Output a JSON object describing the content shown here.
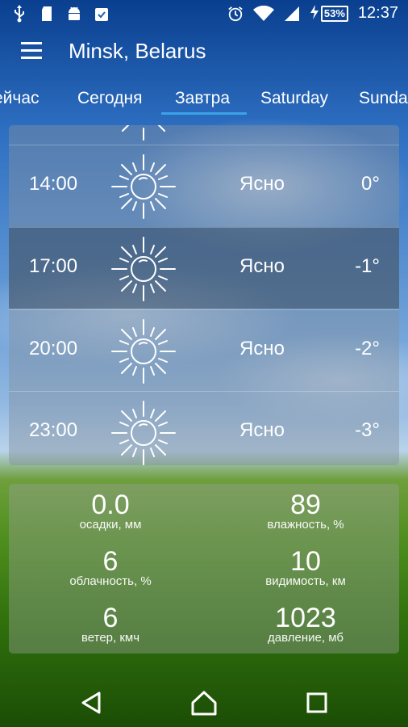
{
  "status_bar": {
    "left_icons": [
      "usb-icon",
      "sd-card-icon",
      "android-icon",
      "clipboard-check-icon"
    ],
    "right_icons": [
      "alarm-icon",
      "wifi-icon",
      "signal-icon",
      "charging-icon"
    ],
    "battery": "53%",
    "time": "12:37"
  },
  "app_bar": {
    "menu_icon": "hamburger-menu-icon",
    "city": "Minsk, Belarus"
  },
  "tabs": [
    {
      "label": "ейчас"
    },
    {
      "label": "Сегодня"
    },
    {
      "label": "Завтра",
      "selected": true
    },
    {
      "label": "Saturday"
    },
    {
      "label": "Sunda"
    }
  ],
  "accent_color": "#3aa3e8",
  "hourly": [
    {
      "time": "14:00",
      "condition": "Ясно",
      "temp": "0°",
      "icon": "sun-icon"
    },
    {
      "time": "17:00",
      "condition": "Ясно",
      "temp": "-1°",
      "icon": "sun-icon"
    },
    {
      "time": "20:00",
      "condition": "Ясно",
      "temp": "-2°",
      "icon": "sun-icon"
    },
    {
      "time": "23:00",
      "condition": "Ясно",
      "temp": "-3°",
      "icon": "sun-icon"
    }
  ],
  "stats": [
    {
      "value": "0.0",
      "label": "осадки, мм"
    },
    {
      "value": "89",
      "label": "влажность, %"
    },
    {
      "value": "6",
      "label": "облачность, %"
    },
    {
      "value": "10",
      "label": "видимость, км"
    },
    {
      "value": "6",
      "label": "ветер, кмч"
    },
    {
      "value": "1023",
      "label": "давление, мб"
    }
  ],
  "nav_bar": {
    "icons": [
      "back-icon",
      "home-icon",
      "recents-icon"
    ]
  }
}
